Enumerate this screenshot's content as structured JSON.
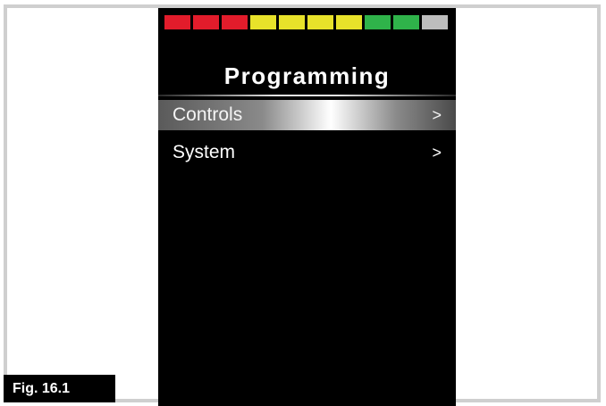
{
  "battery": {
    "segments": [
      "#e21c2b",
      "#e21c2b",
      "#e21c2b",
      "#e8e22a",
      "#e8e22a",
      "#e8e22a",
      "#e8e22a",
      "#2fb34a",
      "#2fb34a",
      "#bdbdbd"
    ]
  },
  "screen": {
    "title": "Programming",
    "menu": [
      {
        "label": "Controls",
        "arrow": ">"
      },
      {
        "label": "System",
        "arrow": ">"
      }
    ]
  },
  "figure": {
    "label": "Fig. 16.1"
  }
}
